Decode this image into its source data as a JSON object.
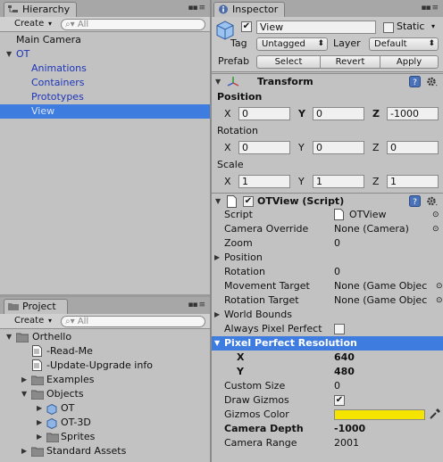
{
  "hierarchy": {
    "tab_title": "Hierarchy",
    "create_label": "Create",
    "search_placeholder": "All",
    "items": [
      "Main Camera",
      "OT",
      "Animations",
      "Containers",
      "Prototypes",
      "View"
    ]
  },
  "project": {
    "tab_title": "Project",
    "create_label": "Create",
    "search_placeholder": "All",
    "items": [
      "Orthello",
      "-Read-Me",
      "-Update-Upgrade info",
      "Examples",
      "Objects",
      "OT",
      "OT-3D",
      "Sprites",
      "Standard Assets"
    ]
  },
  "inspector": {
    "tab_title": "Inspector",
    "object_name": "View",
    "static_label": "Static",
    "tag_label": "Tag",
    "tag_value": "Untagged",
    "layer_label": "Layer",
    "layer_value": "Default",
    "prefab_label": "Prefab",
    "select_label": "Select",
    "revert_label": "Revert",
    "apply_label": "Apply",
    "transform": {
      "title": "Transform",
      "position_label": "Position",
      "rotation_label": "Rotation",
      "scale_label": "Scale",
      "x": "X",
      "y": "Y",
      "z": "Z",
      "position": [
        "0",
        "0",
        "-1000"
      ],
      "rotation": [
        "0",
        "0",
        "0"
      ],
      "scale": [
        "1",
        "1",
        "1"
      ]
    },
    "script": {
      "title": "OTView (Script)",
      "rows": [
        {
          "label": "Script",
          "value": "OTView"
        },
        {
          "label": "Camera Override",
          "value": "None (Camera)"
        },
        {
          "label": "Zoom",
          "value": "0"
        },
        {
          "label": "Position",
          "value": ""
        },
        {
          "label": "Rotation",
          "value": "0"
        },
        {
          "label": "Movement Target",
          "value": "None (Game Objec"
        },
        {
          "label": "Rotation Target",
          "value": "None (Game Objec"
        },
        {
          "label": "World Bounds",
          "value": ""
        },
        {
          "label": "Always Pixel Perfect",
          "value": ""
        }
      ],
      "ppr_label": "Pixel Perfect Resolution",
      "ppr_x_label": "X",
      "ppr_x": "640",
      "ppr_y_label": "Y",
      "ppr_y": "480",
      "rows2": [
        {
          "label": "Custom Size",
          "value": "0"
        },
        {
          "label": "Draw Gizmos",
          "value": ""
        },
        {
          "label": "Gizmos Color",
          "value": ""
        },
        {
          "label": "Camera Depth",
          "value": "-1000"
        },
        {
          "label": "Camera Range",
          "value": "2001"
        }
      ],
      "gizmos_color": "#f5e400"
    }
  },
  "colors": {
    "selection": "#3e7ce0",
    "accent_blue_text": "#1d35b8"
  }
}
